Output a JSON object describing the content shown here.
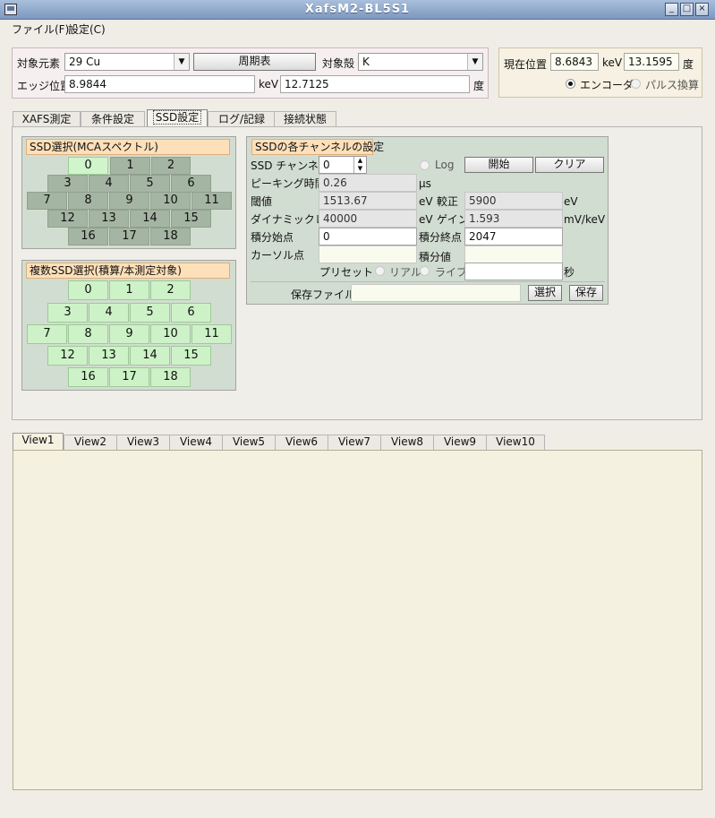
{
  "window": {
    "title": "XafsM2-BL5S1",
    "min": "_",
    "max": "□",
    "close": "×"
  },
  "menu": {
    "file": "ファイル(F)",
    "settings": "設定(C)"
  },
  "target": {
    "element_label": "対象元素",
    "element_value": "29 Cu",
    "periodic_table_button": "周期表",
    "shell_label": "対象殻",
    "shell_value": "K",
    "edge_label": "エッジ位置",
    "edge_kev": "8.9844",
    "kev_unit": "keV",
    "edge_deg": "12.7125",
    "deg_unit": "度"
  },
  "position": {
    "label": "現在位置",
    "kev_value": "8.6843",
    "kev_unit": "keV",
    "deg_value": "13.1595",
    "deg_unit": "度",
    "encoder_label": "エンコーダ",
    "pulse_label": "パルス換算"
  },
  "tabs": [
    "XAFS測定",
    "条件設定",
    "SSD設定",
    "ログ/記録",
    "接続状態"
  ],
  "ssd_select": {
    "title": "SSD選択(MCAスペクトル)",
    "rows": [
      [
        "0",
        "1",
        "2"
      ],
      [
        "3",
        "4",
        "5",
        "6"
      ],
      [
        "7",
        "8",
        "9",
        "10",
        "11"
      ],
      [
        "12",
        "13",
        "14",
        "15"
      ],
      [
        "16",
        "17",
        "18"
      ]
    ]
  },
  "multi_ssd": {
    "title": "複数SSD選択(積算/本測定対象)",
    "rows": [
      [
        "0",
        "1",
        "2"
      ],
      [
        "3",
        "4",
        "5",
        "6"
      ],
      [
        "7",
        "8",
        "9",
        "10",
        "11"
      ],
      [
        "12",
        "13",
        "14",
        "15"
      ],
      [
        "16",
        "17",
        "18"
      ]
    ]
  },
  "channel": {
    "title": "SSDの各チャンネルの設定",
    "ssd_channel_label": "SSD チャンネル",
    "ssd_channel_value": "0",
    "log_label": "Log",
    "start_button": "開始",
    "clear_button": "クリア",
    "peaking_label": "ピーキング時間",
    "peaking_value": "0.26",
    "peaking_unit": "μs",
    "threshold_label": "閾値",
    "threshold_value": "1513.67",
    "threshold_unit": "eV",
    "calib_label": "較正",
    "calib_value": "5900",
    "calib_unit": "eV",
    "dynamic_label": "ダイナミックレンジ",
    "dynamic_value": "40000",
    "dynamic_unit": "eV",
    "gain_label": "ゲイン",
    "gain_value": "1.593",
    "gain_unit": "mV/keV",
    "int_start_label": "積分始点",
    "int_start_value": "0",
    "int_end_label": "積分終点",
    "int_end_value": "2047",
    "cursor_label": "カーソル点",
    "cursor_value": "",
    "int_value_label": "積分値",
    "int_value_value": "",
    "preset_label": "プリセット",
    "real_label": "リアル",
    "live_label": "ライブ",
    "preset_value": "",
    "sec_unit": "秒",
    "save_file_label": "保存ファイル:",
    "save_file_value": "",
    "select_button": "選択",
    "save_button": "保存"
  },
  "views": [
    "View1",
    "View2",
    "View3",
    "View4",
    "View5",
    "View6",
    "View7",
    "View8",
    "View9",
    "View10"
  ]
}
